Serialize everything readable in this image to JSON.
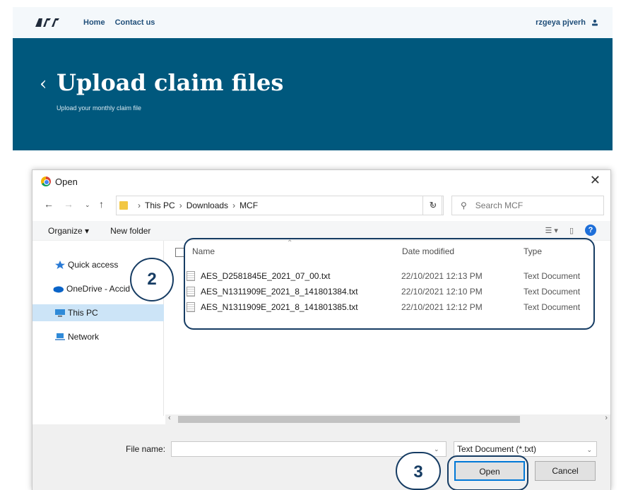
{
  "header": {
    "logo_text": "ACC",
    "nav": [
      "Home",
      "Contact us"
    ],
    "user_name": "rzgeya pjverh"
  },
  "banner": {
    "back_glyph": "‹",
    "title": "Upload claim files",
    "subtitle": "Upload your monthly claim file"
  },
  "dialog": {
    "title": "Open",
    "close_glyph": "✕",
    "breadcrumb": [
      "This PC",
      "Downloads",
      "MCF"
    ],
    "search_placeholder": "Search MCF",
    "toolbar": {
      "organize": "Organize ▾",
      "new_folder": "New folder"
    },
    "nav_items": [
      {
        "label": "Quick access",
        "icon": "star-icon"
      },
      {
        "label": "OneDrive - Accid",
        "icon": "cloud-icon"
      },
      {
        "label": "This PC",
        "icon": "computer-icon"
      },
      {
        "label": "Network",
        "icon": "network-icon"
      }
    ],
    "columns": {
      "name": "Name",
      "date": "Date modified",
      "type": "Type"
    },
    "files": [
      {
        "name": "AES_D2581845E_2021_07_00.txt",
        "date": "22/10/2021 12:13 PM",
        "type": "Text Document"
      },
      {
        "name": "AES_N1311909E_2021_8_141801384.txt",
        "date": "22/10/2021 12:10 PM",
        "type": "Text Document"
      },
      {
        "name": "AES_N1311909E_2021_8_141801385.txt",
        "date": "22/10/2021 12:12 PM",
        "type": "Text Document"
      }
    ],
    "file_name_label": "File name:",
    "file_name_value": "",
    "file_type": "Text Document (*.txt)",
    "open_label": "Open",
    "cancel_label": "Cancel"
  },
  "annotations": {
    "step_files": "2",
    "step_open": "3"
  },
  "colors": {
    "banner": "#00587d",
    "annotation": "#163c63",
    "accent": "#0078d7"
  }
}
